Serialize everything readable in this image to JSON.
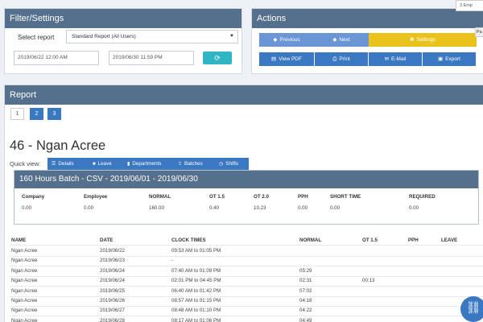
{
  "filter": {
    "title": "Filter/Settings",
    "select_label": "Select report",
    "report_select": "Standard Report (All Users)",
    "date_from": "2019/06/22 12:00 AM",
    "date_to": "2019/06/30 11:59 PM",
    "refresh_icon": "refresh-icon"
  },
  "actions": {
    "title": "Actions",
    "previous": "Previous",
    "next": "Next",
    "settings": "Settings",
    "view_pdf": "View PDF",
    "print": "Print",
    "email": "E-Mail",
    "export": "Export",
    "colors": {
      "blue": "#6b96d6",
      "yellow": "#e9c21c",
      "dark": "#3b78c2"
    }
  },
  "corner": {
    "tooltip": "3 Emp",
    "side_tab": "Pa"
  },
  "report": {
    "title": "Report",
    "pages": [
      "1",
      "2",
      "3"
    ],
    "employee_title": "46 - Ngan Acree",
    "quick_view_label": "Quick view:",
    "quick_view": [
      "Details",
      "Leave",
      "Departments",
      "Batches",
      "Shifts"
    ],
    "batch": {
      "title": "160 Hours Batch - CSV - 2019/06/01 - 2019/06/30",
      "headers": [
        "Company",
        "Employee",
        "NORMAL",
        "OT 1.5",
        "OT 2.0",
        "PPH",
        "SHORT TIME",
        "REQUIRED"
      ],
      "values": [
        "0.00",
        "0.00",
        "160.00",
        "0.40",
        "10.23",
        "0.00",
        "0.00",
        "0.00"
      ]
    },
    "table": {
      "headers": [
        "NAME",
        "DATE",
        "CLOCK TIMES",
        "NORMAL",
        "OT 1.5",
        "PPH",
        "LEAVE"
      ],
      "rows": [
        [
          "Ngan Acree",
          "2019/06/22",
          "09:53 AM to 01:05 PM",
          "",
          "",
          "",
          ""
        ],
        [
          "Ngan Acree",
          "2019/06/23",
          "-",
          "",
          "",
          "",
          ""
        ],
        [
          "Ngan Acree",
          "2019/06/24",
          "07:40 AM to 01:09 PM",
          "05:29",
          "",
          "",
          ""
        ],
        [
          "Ngan Acree",
          "2019/06/24",
          "02:01 PM to 04:45 PM",
          "02:31",
          "00:13",
          "",
          ""
        ],
        [
          "Ngan Acree",
          "2019/06/25",
          "06:40 AM to 01:42 PM",
          "07:02",
          "",
          "",
          ""
        ],
        [
          "Ngan Acree",
          "2019/06/26",
          "08:57 AM to 01:15 PM",
          "04:18",
          "",
          "",
          ""
        ],
        [
          "Ngan Acree",
          "2019/06/27",
          "08:48 AM to 01:10 PM",
          "04:22",
          "",
          "",
          ""
        ],
        [
          "Ngan Acree",
          "2019/06/28",
          "08:17 AM to 01:06 PM",
          "04:49",
          "",
          "",
          ""
        ]
      ]
    }
  }
}
